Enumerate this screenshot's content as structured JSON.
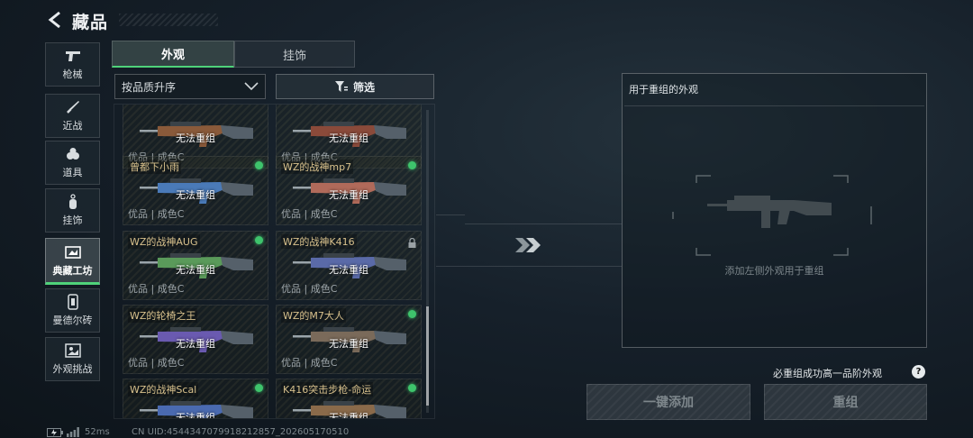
{
  "header": {
    "title": "藏品",
    "back_icon": "back-arrow-icon"
  },
  "sidebar": [
    {
      "label": "枪械",
      "icon": "pistol-icon",
      "active": false
    },
    {
      "label": "近战",
      "icon": "knife-icon",
      "active": false
    },
    {
      "label": "道具",
      "icon": "grenade-icon",
      "active": false
    },
    {
      "label": "挂饰",
      "icon": "charm-icon",
      "active": false
    },
    {
      "label": "典藏工坊",
      "icon": "workshop-icon",
      "active": true
    },
    {
      "label": "曼德尔砖",
      "icon": "brick-icon",
      "active": false
    },
    {
      "label": "外观挑战",
      "icon": "challenge-icon",
      "active": false
    }
  ],
  "tabs": {
    "appearance": "外观",
    "charm": "挂饰"
  },
  "sort": {
    "label": "按品质升序"
  },
  "filter": {
    "label": "筛选"
  },
  "items": [
    {
      "name": "",
      "status": "无法重组",
      "quality": "优品 | 成色C",
      "badge": "none",
      "gun_color": "#8a5a3a"
    },
    {
      "name": "",
      "status": "无法重组",
      "quality": "优品 | 成色C",
      "badge": "none",
      "gun_color": "#8a4a3a"
    },
    {
      "name": "曾都下小雨",
      "status": "无法重组",
      "quality": "优品 | 成色C",
      "badge": "dot",
      "gun_color": "#4a7ab8"
    },
    {
      "name": "WZ的战神mp7",
      "status": "无法重组",
      "quality": "优品 | 成色C",
      "badge": "dot",
      "gun_color": "#b06a5a"
    },
    {
      "name": "WZ的战神AUG",
      "status": "无法重组",
      "quality": "优品 | 成色C",
      "badge": "dot",
      "gun_color": "#5a9a5a"
    },
    {
      "name": "WZ的战神K416",
      "status": "无法重组",
      "quality": "优品 | 成色C",
      "badge": "lock",
      "gun_color": "#5a6aa8"
    },
    {
      "name": "WZ的轮椅之王",
      "status": "无法重组",
      "quality": "优品 | 成色C",
      "badge": "none",
      "gun_color": "#6a5ab0"
    },
    {
      "name": "WZ的M7大人",
      "status": "无法重组",
      "quality": "优品 | 成色C",
      "badge": "dot",
      "gun_color": "#7a6a5a"
    },
    {
      "name": "WZ的战神Scal",
      "status": "无法重组",
      "quality": "",
      "badge": "dot",
      "gun_color": "#4a6ab0"
    },
    {
      "name": "K416突击步枪-命运",
      "status": "无法重组",
      "quality": "",
      "badge": "dot",
      "gun_color": "#8a6a4a"
    }
  ],
  "panel": {
    "title": "用于重组的外观",
    "hint": "添加左侧外观用于重组"
  },
  "guarantee": {
    "label": "必重组成功高一品阶外观",
    "help": "?"
  },
  "buttons": {
    "quick_add": "一键添加",
    "remake": "重组"
  },
  "footer": {
    "ping": "52ms",
    "uid": "CN UID:4544347079918212857_202605170510"
  },
  "colors": {
    "accent": "#4fd27a",
    "card_name": "#d7c08c"
  }
}
